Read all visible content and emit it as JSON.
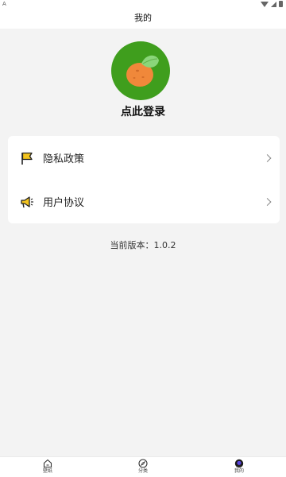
{
  "status": {
    "left_glyph": "A"
  },
  "header": {
    "title": "我的"
  },
  "profile": {
    "login_label": "点此登录"
  },
  "menu": {
    "items": [
      {
        "label": "隐私政策",
        "icon": "flag-icon"
      },
      {
        "label": "用户协议",
        "icon": "megaphone-icon"
      }
    ]
  },
  "version": {
    "text": "当前版本：1.0.2"
  },
  "tabs": [
    {
      "label": "壁纸",
      "icon": "home-icon"
    },
    {
      "label": "分类",
      "icon": "compass-icon"
    },
    {
      "label": "我的",
      "icon": "profile-icon"
    }
  ],
  "colors": {
    "avatar_bg": "#3f9e1d",
    "orange": "#f0883a",
    "leaf": "#8bd67a",
    "accent_yellow": "#f3c41f"
  }
}
